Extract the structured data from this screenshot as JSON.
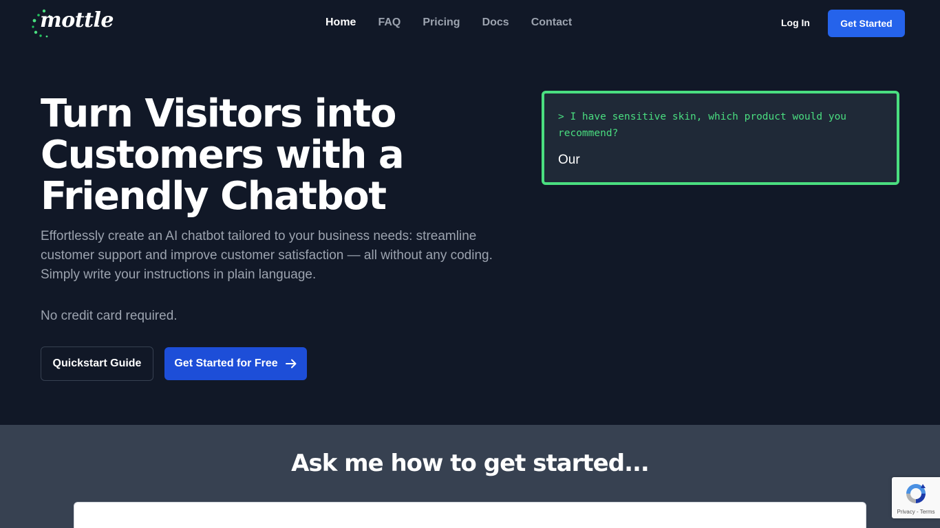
{
  "nav": {
    "brand": "mottle",
    "links": [
      {
        "label": "Home",
        "active": true
      },
      {
        "label": "FAQ",
        "active": false
      },
      {
        "label": "Pricing",
        "active": false
      },
      {
        "label": "Docs",
        "active": false
      },
      {
        "label": "Contact",
        "active": false
      }
    ],
    "login_label": "Log In",
    "cta_label": "Get Started"
  },
  "hero": {
    "title_lines": [
      "Turn Visitors into",
      "Customers with a",
      "Friendly Chatbot"
    ],
    "description_lines": [
      "Effortlessly create an AI chatbot tailored to your business needs: streamline",
      "customer support and improve customer satisfaction — all without any coding.",
      "Simply write your instructions in plain language."
    ],
    "no_card": "No credit card required.",
    "quickstart_label": "Quickstart Guide",
    "free_label": "Get Started for Free",
    "free_icon": "arrow-right-icon"
  },
  "terminal": {
    "prompt_lines": [
      "> I have sensitive skin, which product would you",
      "recommend?"
    ],
    "response": "Our"
  },
  "ask": {
    "title": "Ask me how to get started..."
  },
  "recaptcha": {
    "privacy": "Privacy",
    "separator": " - ",
    "terms": "Terms",
    "icon": "recaptcha-icon"
  },
  "colors": {
    "background": "#111827",
    "accent_blue": "#2563eb",
    "terminal_green": "#4ade80",
    "section_gray": "#374151"
  }
}
